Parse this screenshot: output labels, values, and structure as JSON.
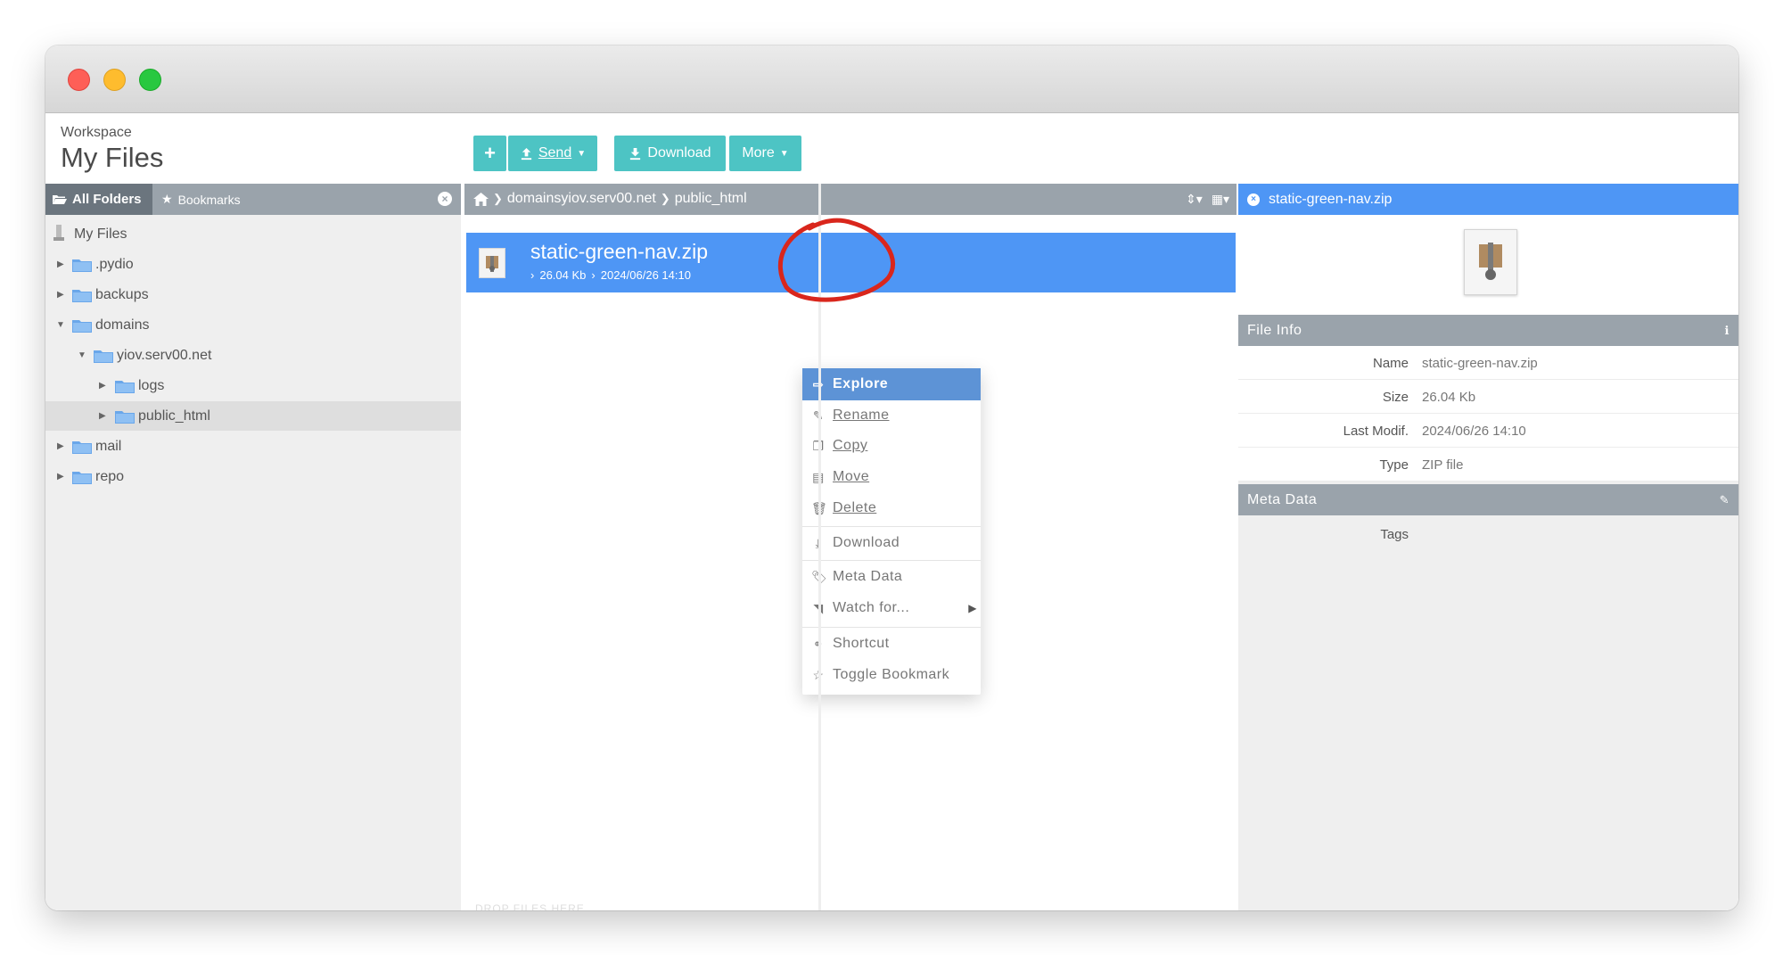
{
  "workspace": {
    "label": "Workspace",
    "title": "My Files"
  },
  "toolbar": {
    "send_label": "Send",
    "download_label": "Download",
    "more_label": "More"
  },
  "left_panel": {
    "tab_all_folders": "All Folders",
    "tab_bookmarks": "Bookmarks",
    "tree": [
      {
        "label": "My Files"
      },
      {
        "label": ".pydio"
      },
      {
        "label": "backups"
      },
      {
        "label": "domains"
      },
      {
        "label": "yiov.serv00.net"
      },
      {
        "label": "logs"
      },
      {
        "label": "public_html"
      },
      {
        "label": "mail"
      },
      {
        "label": "repo"
      }
    ]
  },
  "breadcrumb": {
    "parts": [
      "domainsyiov.serv00.net",
      "public_html"
    ]
  },
  "file": {
    "name": "static-green-nav.zip",
    "size": "26.04 Kb",
    "modified": "2024/06/26 14:10"
  },
  "context_menu": {
    "items": [
      "Explore",
      "Rename",
      "Copy",
      "Move",
      "Delete",
      "Download",
      "Meta Data",
      "Watch for...",
      "Shortcut",
      "Toggle Bookmark"
    ]
  },
  "right_panel": {
    "title": "static-green-nav.zip",
    "file_info_title": "File Info",
    "rows": [
      {
        "key": "Name",
        "value": "static-green-nav.zip"
      },
      {
        "key": "Size",
        "value": "26.04 Kb"
      },
      {
        "key": "Last Modif.",
        "value": "2024/06/26 14:10"
      },
      {
        "key": "Type",
        "value": "ZIP file"
      }
    ],
    "meta_data_title": "Meta Data",
    "tags_label": "Tags"
  },
  "drop_hint": "DROP FILES HERE",
  "colors": {
    "accent": "#4dc4c4",
    "selection": "#4e96f5",
    "panel_header": "#9aa3ab",
    "annotation": "#d9261c"
  }
}
